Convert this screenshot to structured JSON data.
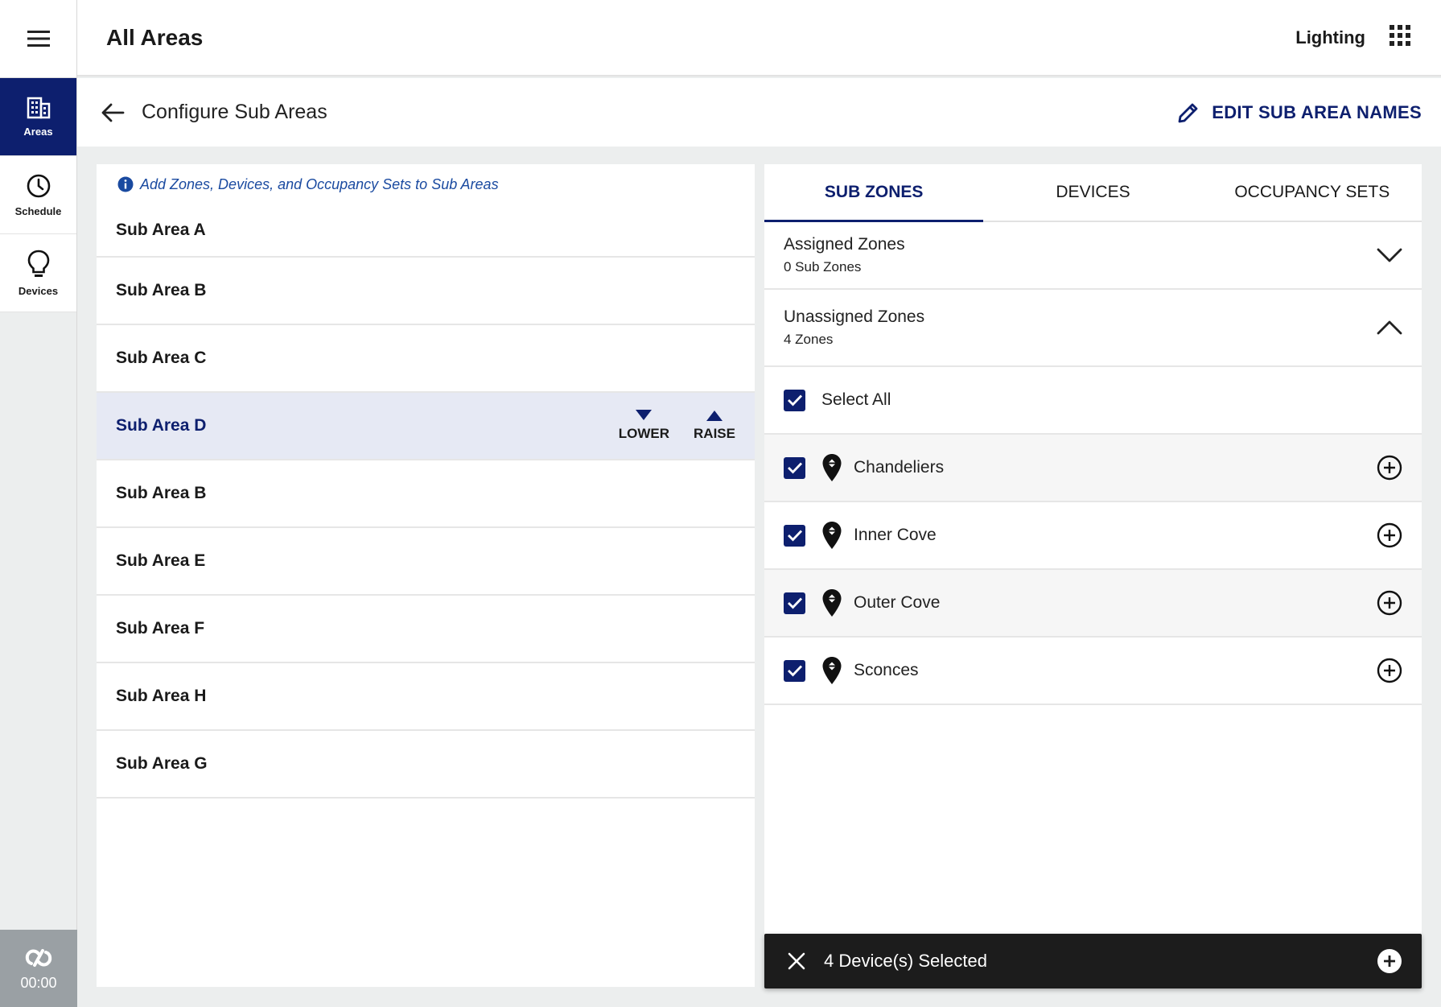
{
  "header": {
    "title": "All Areas",
    "app_name": "Lighting"
  },
  "rail": {
    "items": [
      {
        "label": "Areas",
        "icon": "building-icon"
      },
      {
        "label": "Schedule",
        "icon": "clock-icon"
      },
      {
        "label": "Devices",
        "icon": "bulb-icon"
      }
    ],
    "clock": "00:00"
  },
  "subheader": {
    "title": "Configure Sub Areas",
    "edit_label": "EDIT SUB AREA NAMES"
  },
  "left": {
    "info": "Add Zones, Devices, and Occupancy Sets to Sub Areas",
    "sub_areas": [
      "Sub Area A",
      "Sub Area B",
      "Sub Area C",
      "Sub Area D",
      "Sub Area B",
      "Sub Area E",
      "Sub Area F",
      "Sub Area H",
      "Sub Area G"
    ],
    "lower_label": "LOWER",
    "raise_label": "RAISE"
  },
  "right": {
    "tabs": [
      "SUB ZONES",
      "DEVICES",
      "OCCUPANCY SETS"
    ],
    "assigned": {
      "title": "Assigned Zones",
      "count": "0 Sub Zones"
    },
    "unassigned": {
      "title": "Unassigned Zones",
      "count": "4 Zones"
    },
    "select_all": "Select All",
    "zones": [
      "Chandeliers",
      "Inner Cove",
      "Outer Cove",
      "Sconces"
    ]
  },
  "snackbar": {
    "message": "4 Device(s) Selected"
  },
  "colors": {
    "primary": "#0d1f6e",
    "selected_row": "#e6e9f4",
    "info_text": "#1a4aa0"
  }
}
